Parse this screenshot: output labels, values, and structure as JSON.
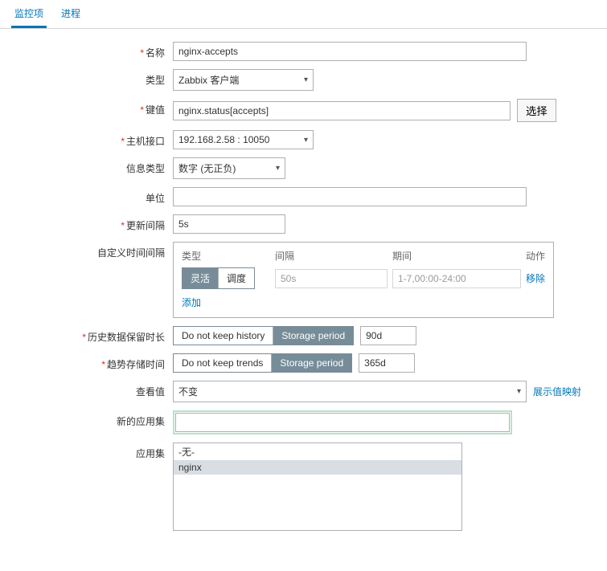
{
  "tabs": {
    "monitor": "监控项",
    "process": "进程",
    "active": "monitor"
  },
  "labels": {
    "name": "名称",
    "type": "类型",
    "key": "键值",
    "hostIface": "主机接口",
    "infoType": "信息类型",
    "unit": "单位",
    "updInterval": "更新间隔",
    "custInterval": "自定义时间间隔",
    "histKeep": "历史数据保留时长",
    "trendKeep": "趋势存储时间",
    "viewVal": "查看值",
    "newAppSet": "新的应用集",
    "appSet": "应用集"
  },
  "fields": {
    "name": "nginx-accepts",
    "type": "Zabbix 客户端",
    "key": "nginx.status[accepts]",
    "selectBtn": "选择",
    "hostIface": "192.168.2.58 : 10050",
    "infoType": "数字 (无正负)",
    "unit": "",
    "updInterval": "5s"
  },
  "intervalBox": {
    "headers": {
      "type": "类型",
      "gap": "间隔",
      "period": "期间",
      "action": "动作"
    },
    "segActive": "灵活",
    "segSched": "调度",
    "gap": "50s",
    "period": "1-7,00:00-24:00",
    "remove": "移除",
    "add": "添加"
  },
  "history": {
    "noKeep": "Do not keep history",
    "storage": "Storage period",
    "val": "90d"
  },
  "trends": {
    "noKeep": "Do not keep trends",
    "storage": "Storage period",
    "val": "365d"
  },
  "viewValue": {
    "val": "不变",
    "mapLink": "展示值映射"
  },
  "newAppSet": "",
  "appSet": {
    "opts": [
      "-无-",
      "nginx"
    ],
    "selected": "nginx"
  }
}
